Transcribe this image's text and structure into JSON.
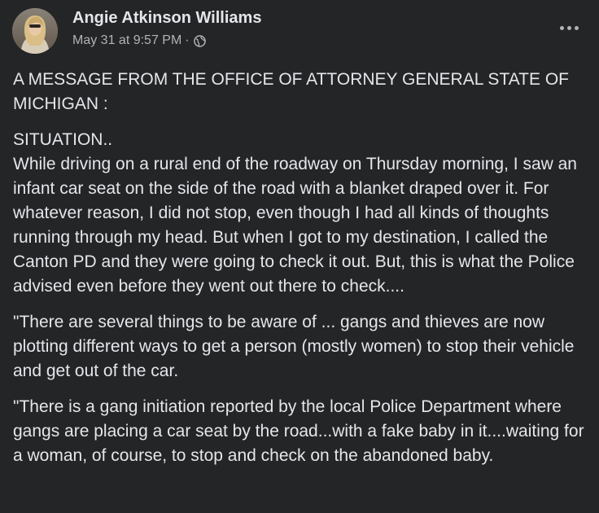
{
  "post": {
    "author_name": "Angie Atkinson Williams",
    "timestamp": "May 31 at 9:57 PM",
    "separator": "·",
    "audience_icon": "globe-icon",
    "more_icon": "more-options-icon",
    "paragraphs": [
      "A MESSAGE FROM THE OFFICE OF ATTORNEY GENERAL STATE OF MICHIGAN :",
      "SITUATION..\nWhile driving on a rural end of the roadway on Thursday morning, I saw an infant car seat on the side of the road with a blanket draped over it.  For whatever reason, I did not stop, even though I had all kinds of thoughts running through my head. But when I got to my destination, I called the Canton PD and they were going to check it out. But, this is what the Police advised even before they went out there to check....",
      "\"There are several things to be aware of ... gangs and thieves are now plotting different ways to get a person (mostly women) to stop their vehicle and get out of the car.",
      "\"There is a gang initiation reported by the local Police Department where gangs are placing a car seat by the road...with a fake baby in it....waiting for a woman, of course, to stop and check on the abandoned baby."
    ]
  },
  "colors": {
    "background": "#242526",
    "primary_text": "#e4e6eb",
    "secondary_text": "#b0b3b8"
  }
}
